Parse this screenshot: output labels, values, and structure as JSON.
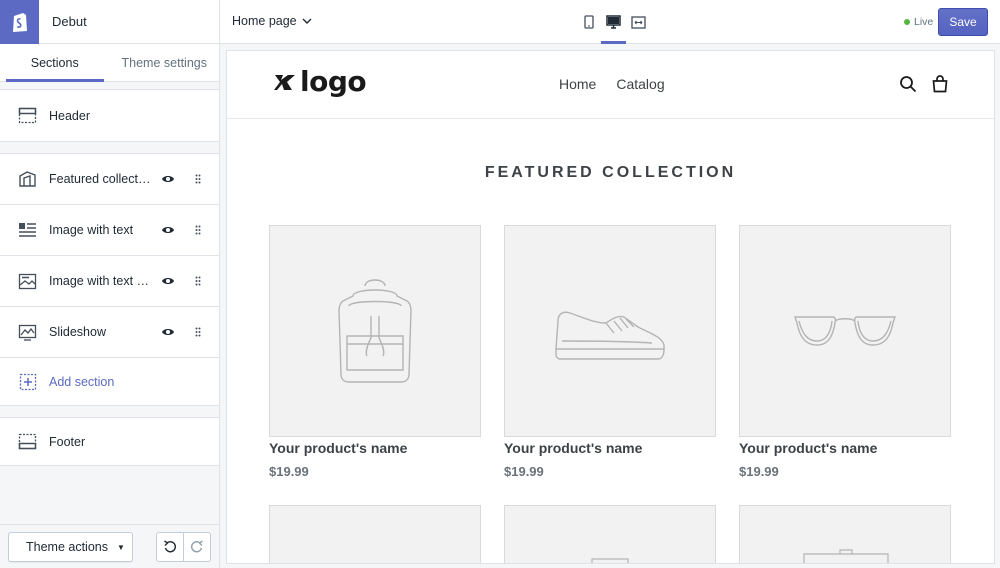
{
  "app": {
    "store_name": "Debut"
  },
  "tabs": [
    {
      "label": "Sections",
      "active": true
    },
    {
      "label": "Theme settings",
      "active": false
    }
  ],
  "sections": {
    "header": {
      "label": "Header",
      "icon": "header-layout-icon"
    },
    "items": [
      {
        "label": "Featured collection",
        "icon": "collection-icon"
      },
      {
        "label": "Image with text",
        "icon": "image-with-text-icon"
      },
      {
        "label": "Image with text overlay",
        "icon": "image-overlay-icon"
      },
      {
        "label": "Slideshow",
        "icon": "slideshow-icon"
      }
    ],
    "add_section": "Add section",
    "footer": {
      "label": "Footer",
      "icon": "footer-layout-icon"
    }
  },
  "bottom": {
    "theme_actions": "Theme actions"
  },
  "topbar": {
    "page": "Home page",
    "status": "Live",
    "save": "Save",
    "active_device": "desktop"
  },
  "colors": {
    "accent": "#5c6ac4",
    "live": "#50b83c"
  },
  "store": {
    "logo_text": "logo",
    "nav": [
      "Home",
      "Catalog"
    ],
    "section_title": "FEATURED COLLECTION",
    "products": [
      {
        "name": "Your product's name",
        "price": "$19.99",
        "icon": "backpack-icon"
      },
      {
        "name": "Your product's name",
        "price": "$19.99",
        "icon": "sneaker-icon"
      },
      {
        "name": "Your product's name",
        "price": "$19.99",
        "icon": "glasses-icon"
      }
    ]
  }
}
